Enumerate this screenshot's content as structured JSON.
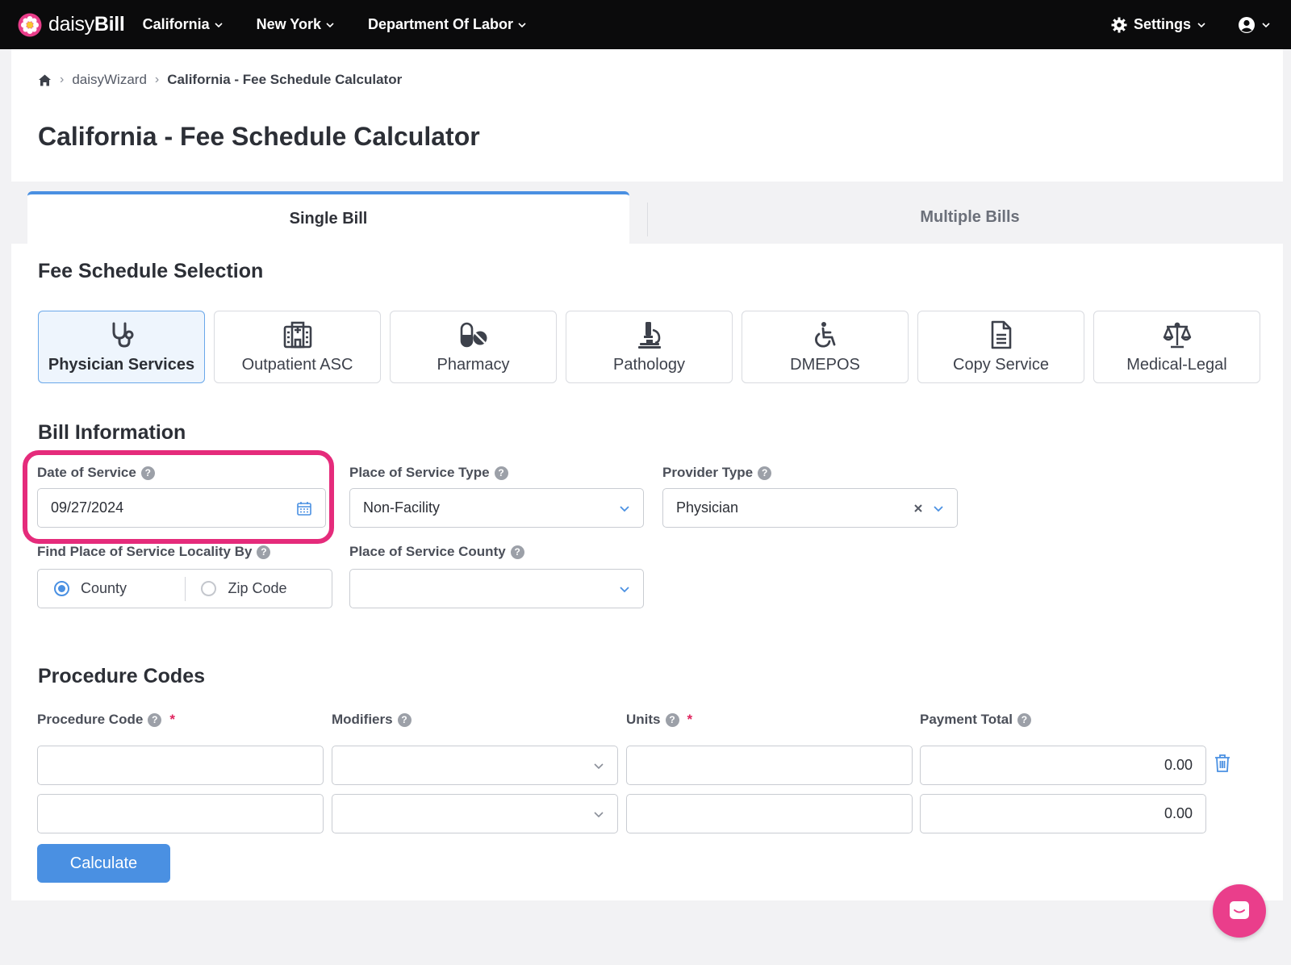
{
  "brand": {
    "prefix": "daisy",
    "suffix": "Bill"
  },
  "nav": {
    "items": [
      {
        "label": "California"
      },
      {
        "label": "New York"
      },
      {
        "label": "Department Of Labor"
      }
    ],
    "settings_label": "Settings"
  },
  "breadcrumb": {
    "item1": "daisyWizard",
    "current": "California - Fee Schedule Calculator"
  },
  "page_title": "California - Fee Schedule Calculator",
  "tabs": {
    "active": "Single Bill",
    "inactive": "Multiple Bills"
  },
  "fee_schedule": {
    "title": "Fee Schedule Selection",
    "selected": "Physician Services",
    "cards": [
      {
        "label": "Physician Services",
        "icon": "stethoscope-icon"
      },
      {
        "label": "Outpatient ASC",
        "icon": "hospital-icon"
      },
      {
        "label": "Pharmacy",
        "icon": "pills-icon"
      },
      {
        "label": "Pathology",
        "icon": "microscope-icon"
      },
      {
        "label": "DMEPOS",
        "icon": "wheelchair-icon"
      },
      {
        "label": "Copy Service",
        "icon": "document-icon"
      },
      {
        "label": "Medical-Legal",
        "icon": "scale-icon"
      }
    ]
  },
  "bill_info": {
    "title": "Bill Information",
    "date_of_service": {
      "label": "Date of Service",
      "value": "09/27/2024"
    },
    "place_of_service_type": {
      "label": "Place of Service Type",
      "value": "Non-Facility"
    },
    "provider_type": {
      "label": "Provider Type",
      "value": "Physician"
    },
    "locality_by": {
      "label": "Find Place of Service Locality By",
      "options": [
        "County",
        "Zip Code"
      ],
      "selected": "County"
    },
    "county": {
      "label": "Place of Service County",
      "value": ""
    }
  },
  "procedure_codes": {
    "title": "Procedure Codes",
    "columns": {
      "code": "Procedure Code",
      "modifiers": "Modifiers",
      "units": "Units",
      "payment": "Payment Total"
    },
    "rows": [
      {
        "code": "",
        "modifiers": "",
        "units": "",
        "payment": "0.00"
      },
      {
        "code": "",
        "modifiers": "",
        "units": "",
        "payment": "0.00"
      }
    ],
    "calculate_label": "Calculate"
  },
  "colors": {
    "accent": "#4a90e2",
    "highlight": "#e52b7b",
    "chat": "#ea3e8b",
    "topbar": "#0b0b0c"
  }
}
